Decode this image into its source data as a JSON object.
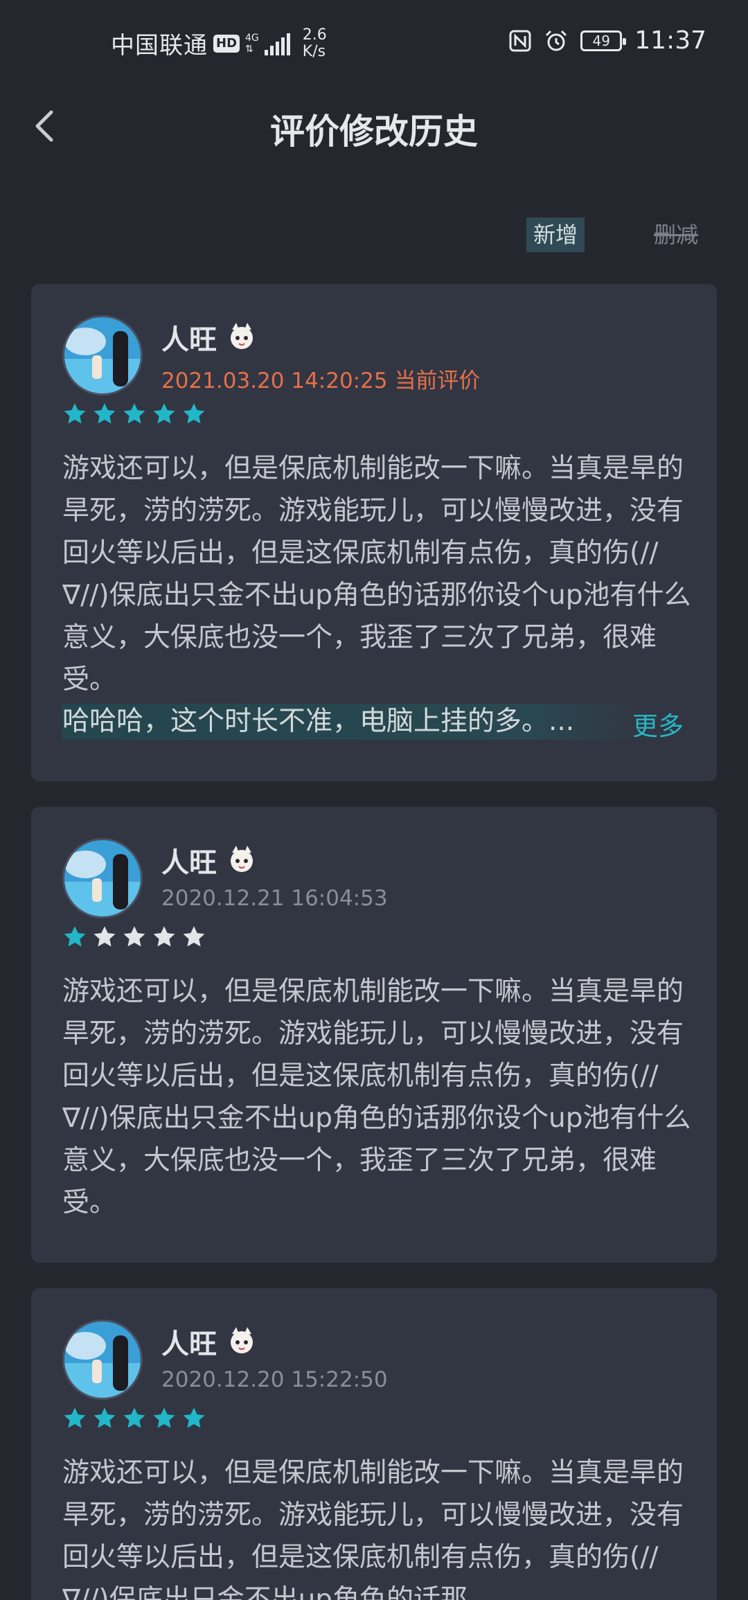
{
  "status_bar": {
    "carrier": "中国联通",
    "hd": "HD",
    "net_type": "4G",
    "speed_value": "2.6",
    "speed_unit": "K/s",
    "battery": "49",
    "time": "11:37"
  },
  "header": {
    "title": "评价修改历史"
  },
  "filters": {
    "add_label": "新增",
    "delete_label": "删减"
  },
  "colors": {
    "background": "#25272f",
    "card": "#323642",
    "accent": "#27b6c4",
    "current_timestamp": "#e6704a",
    "star_filled": "#22b7c8",
    "star_empty": "#e4e5e9"
  },
  "reviews": [
    {
      "user_name": "人旺",
      "timestamp": "2021.03.20 14:20:25",
      "current_label": "当前评价",
      "rating": 5,
      "text": "游戏还可以，但是保底机制能改一下嘛。当真是旱的旱死，涝的涝死。游戏能玩儿，可以慢慢改进，没有回火等以后出，但是这保底机制有点伤，真的伤(//∇//)保底出只金不出up角色的话那你设个up池有什么意义，大保底也没一个，我歪了三次了兄弟，很难受。",
      "reply_text": "哈哈哈，这个时长不准，电脑上挂的多。...",
      "more_label": "更多"
    },
    {
      "user_name": "人旺",
      "timestamp": "2020.12.21 16:04:53",
      "rating": 1,
      "text": "游戏还可以，但是保底机制能改一下嘛。当真是旱的旱死，涝的涝死。游戏能玩儿，可以慢慢改进，没有回火等以后出，但是这保底机制有点伤，真的伤(//∇//)保底出只金不出up角色的话那你设个up池有什么意义，大保底也没一个，我歪了三次了兄弟，很难受。"
    },
    {
      "user_name": "人旺",
      "timestamp": "2020.12.20 15:22:50",
      "rating": 5,
      "text": "游戏还可以，但是保底机制能改一下嘛。当真是旱的旱死，涝的涝死。游戏能玩儿，可以慢慢改进，没有回火等以后出，但是这保底机制有点伤，真的伤(//∇//)保底出只金不出up角色的话那"
    }
  ]
}
